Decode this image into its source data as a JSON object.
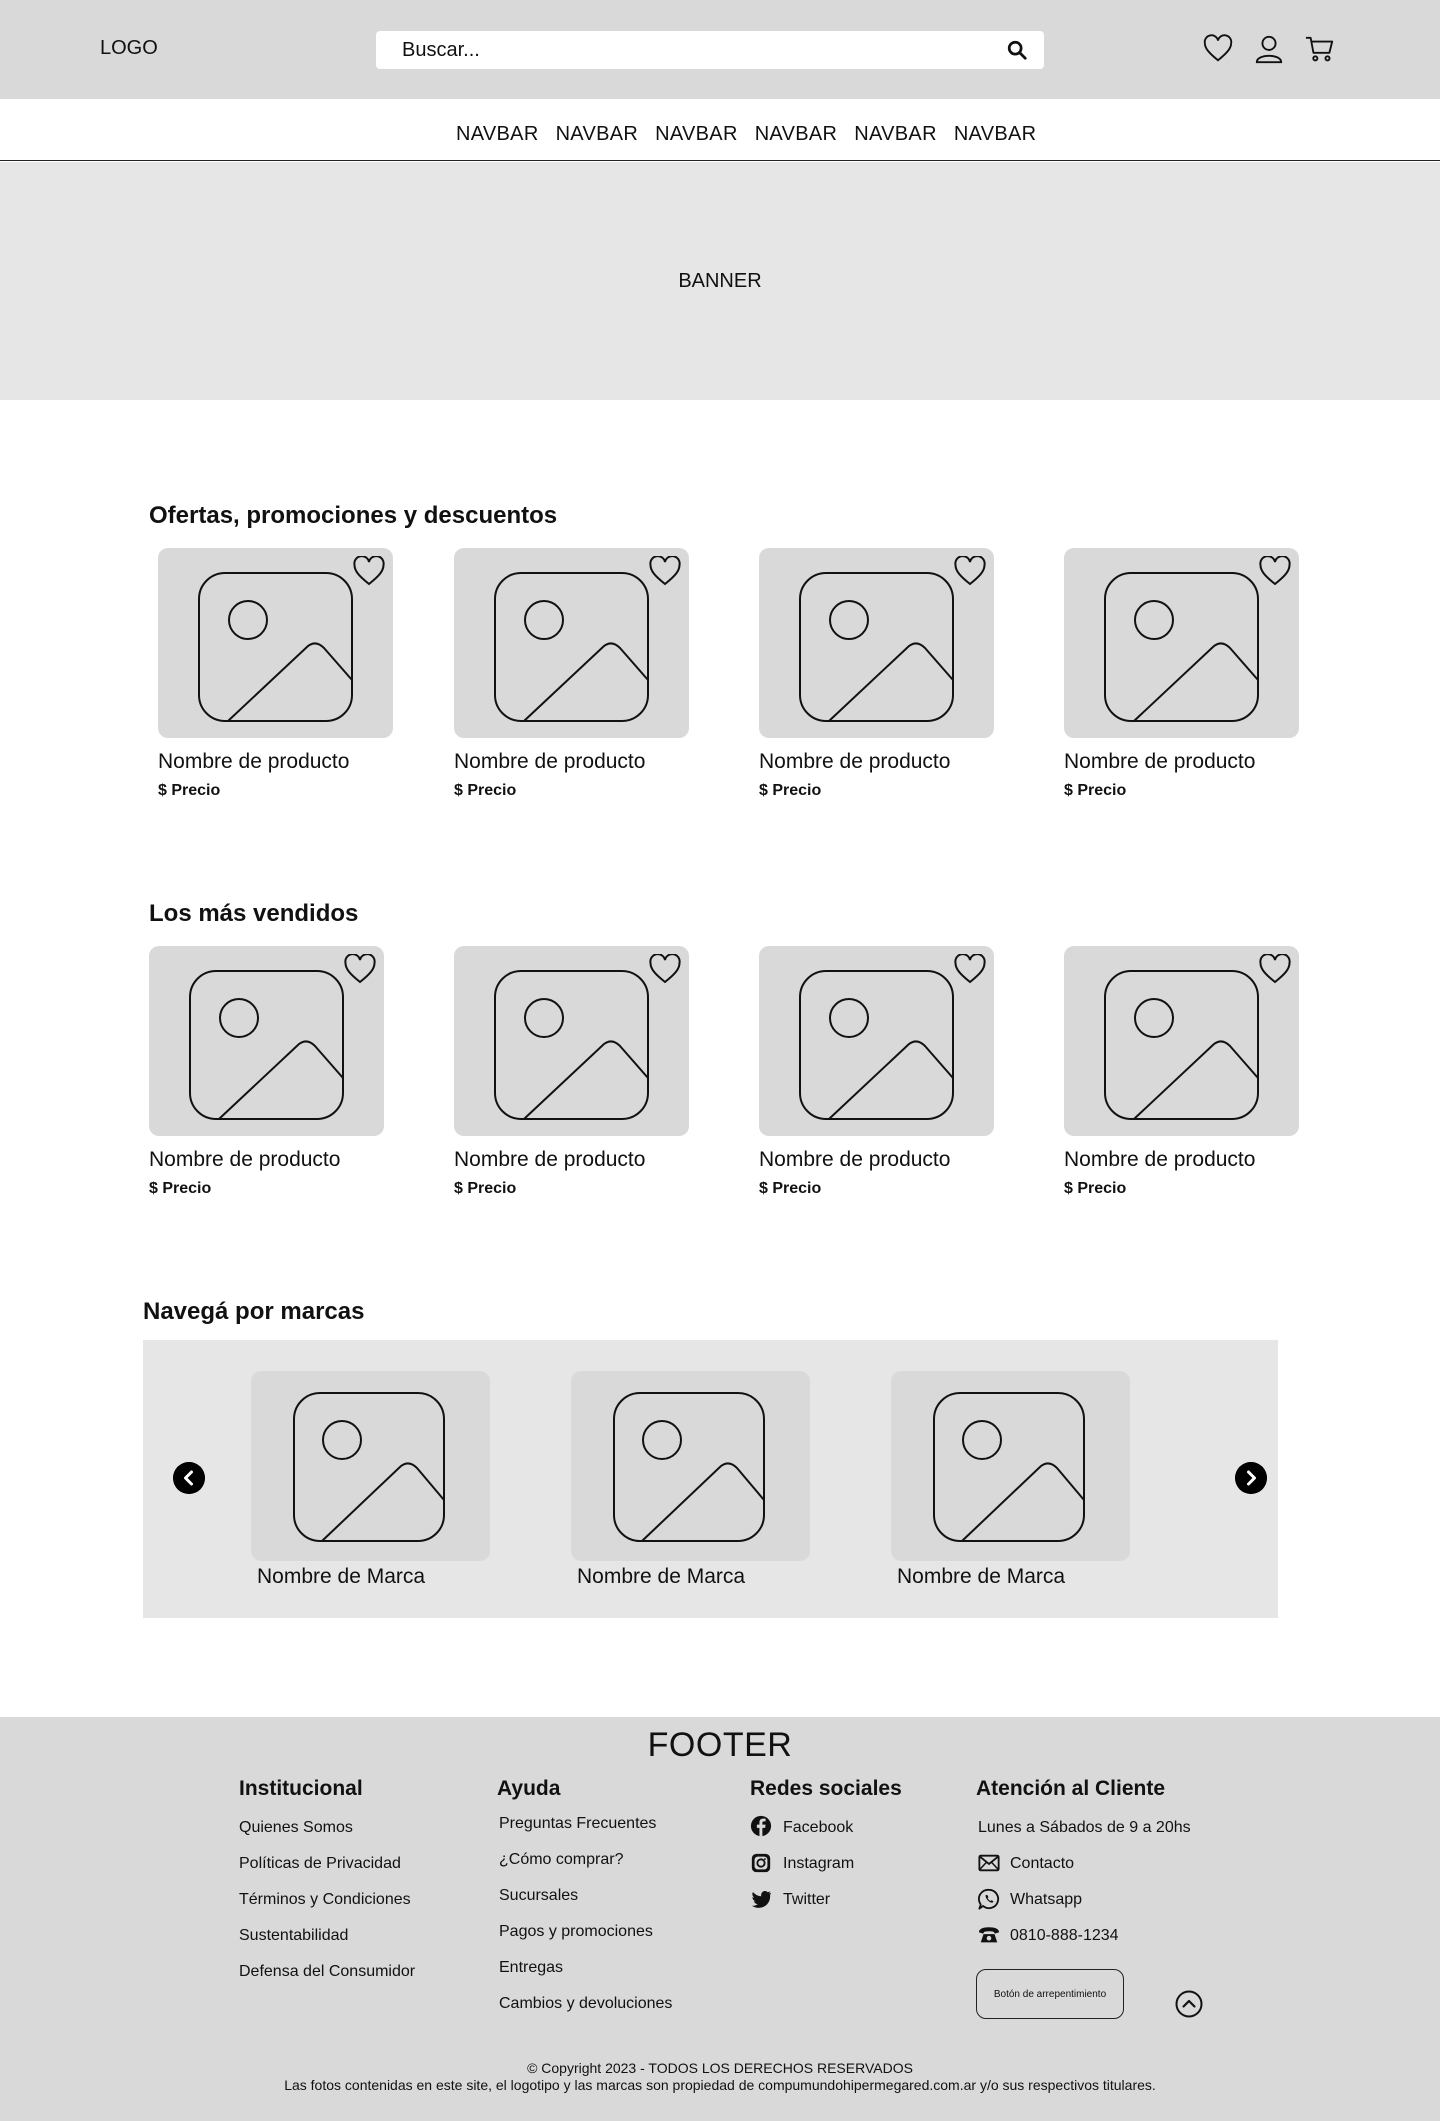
{
  "header": {
    "logo": "LOGO",
    "search_placeholder": "Buscar...",
    "icons": [
      "heart-icon",
      "user-icon",
      "cart-icon"
    ]
  },
  "navbar": {
    "items": [
      "NAVBAR",
      "NAVBAR",
      "NAVBAR",
      "NAVBAR",
      "NAVBAR",
      "NAVBAR"
    ]
  },
  "banner": {
    "text": "BANNER"
  },
  "offers": {
    "title": "Ofertas, promociones y descuentos",
    "products": [
      {
        "name": "Nombre de producto",
        "price": "$ Precio"
      },
      {
        "name": "Nombre de producto",
        "price": "$ Precio"
      },
      {
        "name": "Nombre de producto",
        "price": "$ Precio"
      },
      {
        "name": "Nombre de producto",
        "price": "$ Precio"
      }
    ]
  },
  "bestsellers": {
    "title": "Los más vendidos",
    "products": [
      {
        "name": "Nombre de producto",
        "price": "$ Precio"
      },
      {
        "name": "Nombre de producto",
        "price": "$ Precio"
      },
      {
        "name": "Nombre de producto",
        "price": "$ Precio"
      },
      {
        "name": "Nombre de producto",
        "price": "$ Precio"
      }
    ]
  },
  "brands": {
    "title": "Navegá por marcas",
    "items": [
      {
        "name": "Nombre de Marca"
      },
      {
        "name": "Nombre de Marca"
      },
      {
        "name": "Nombre de Marca"
      }
    ]
  },
  "footer": {
    "title": "FOOTER",
    "institucional": {
      "title": "Institucional",
      "links": [
        "Quienes Somos",
        "Políticas de Privacidad",
        "Términos y Condiciones",
        "Sustentabilidad",
        "Defensa del Consumidor"
      ]
    },
    "ayuda": {
      "title": "Ayuda",
      "links": [
        "Preguntas Frecuentes",
        "¿Cómo comprar?",
        "Sucursales",
        "Pagos y promociones",
        "Entregas",
        "Cambios y devoluciones"
      ]
    },
    "redes": {
      "title": "Redes sociales",
      "links": [
        "Facebook",
        "Instagram",
        "Twitter"
      ]
    },
    "atencion": {
      "title": "Atención al Cliente",
      "hours": "Lunes a Sábados de 9 a 20hs",
      "contact": "Contacto",
      "whatsapp": "Whatsapp",
      "phone": "0810-888-1234",
      "regret_button": "Botón de arrepentimiento"
    },
    "copyright_line1": "© Copyright 2023 - TODOS LOS DERECHOS RESERVADOS",
    "copyright_line2": "Las fotos contenidas en este site, el logotipo y las marcas son propiedad de compumundohipermegared.com.ar y/o sus respectivos titulares."
  }
}
